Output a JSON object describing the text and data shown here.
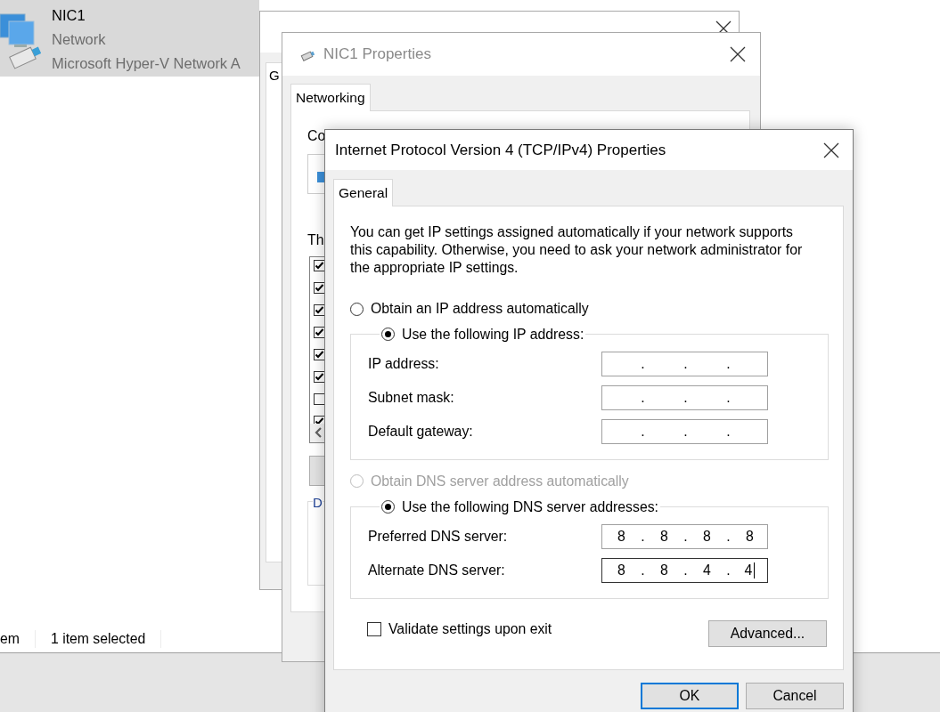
{
  "explorer": {
    "item": {
      "name": "NIC1",
      "category": "Network",
      "device": "Microsoft Hyper-V Network A",
      "selected": true
    },
    "status_bar": [
      {
        "text": "em"
      },
      {
        "text": "1 item selected"
      }
    ]
  },
  "status_window": {
    "tabs": [
      {
        "label": "G",
        "selected": true
      }
    ]
  },
  "properties_window": {
    "title": "NIC1 Properties",
    "active": false,
    "tabs": [
      {
        "label": "Networking",
        "selected": true
      }
    ],
    "connect_label": "Co",
    "components_label": "Th",
    "components": [
      {
        "checked": true
      },
      {
        "checked": true
      },
      {
        "checked": true
      },
      {
        "checked": true
      },
      {
        "checked": true
      },
      {
        "checked": true
      },
      {
        "checked": false
      },
      {
        "checked": true
      }
    ],
    "description_group": "D"
  },
  "ipv4_window": {
    "title": "Internet Protocol Version 4 (TCP/IPv4) Properties",
    "active": true,
    "tabs": [
      {
        "label": "General",
        "selected": true
      }
    ],
    "intro": "You can get IP settings assigned automatically if your network supports this capability. Otherwise, you need to ask your network administrator for the appropriate IP settings.",
    "ip_options": [
      {
        "label": "Obtain an IP address automatically",
        "selected": false,
        "disabled": false
      },
      {
        "label": "Use the following IP address:",
        "selected": true,
        "disabled": false
      }
    ],
    "ip_fields": [
      {
        "label": "IP address:",
        "separator": ".",
        "focused": false
      },
      {
        "label": "Subnet mask:",
        "separator": ".",
        "focused": false
      },
      {
        "label": "Default gateway:",
        "separator": ".",
        "focused": false
      }
    ],
    "dns_options": [
      {
        "label": "Obtain DNS server address automatically",
        "selected": false,
        "disabled": true
      },
      {
        "label": "Use the following DNS server addresses:",
        "selected": true,
        "disabled": false
      }
    ],
    "dns_fields": [
      {
        "label": "Preferred DNS server:",
        "separator": ".",
        "octets": [
          "8",
          "8",
          "8",
          "8"
        ],
        "focused": false
      },
      {
        "label": "Alternate DNS server:",
        "separator": ".",
        "octets": [
          "8",
          "8",
          "4",
          "4"
        ],
        "focused": true
      }
    ],
    "validate": {
      "label": "Validate settings upon exit",
      "checked": false
    },
    "advanced_button": "Advanced...",
    "buttons": [
      {
        "label": "OK",
        "default": true
      },
      {
        "label": "Cancel",
        "default": false
      }
    ]
  }
}
